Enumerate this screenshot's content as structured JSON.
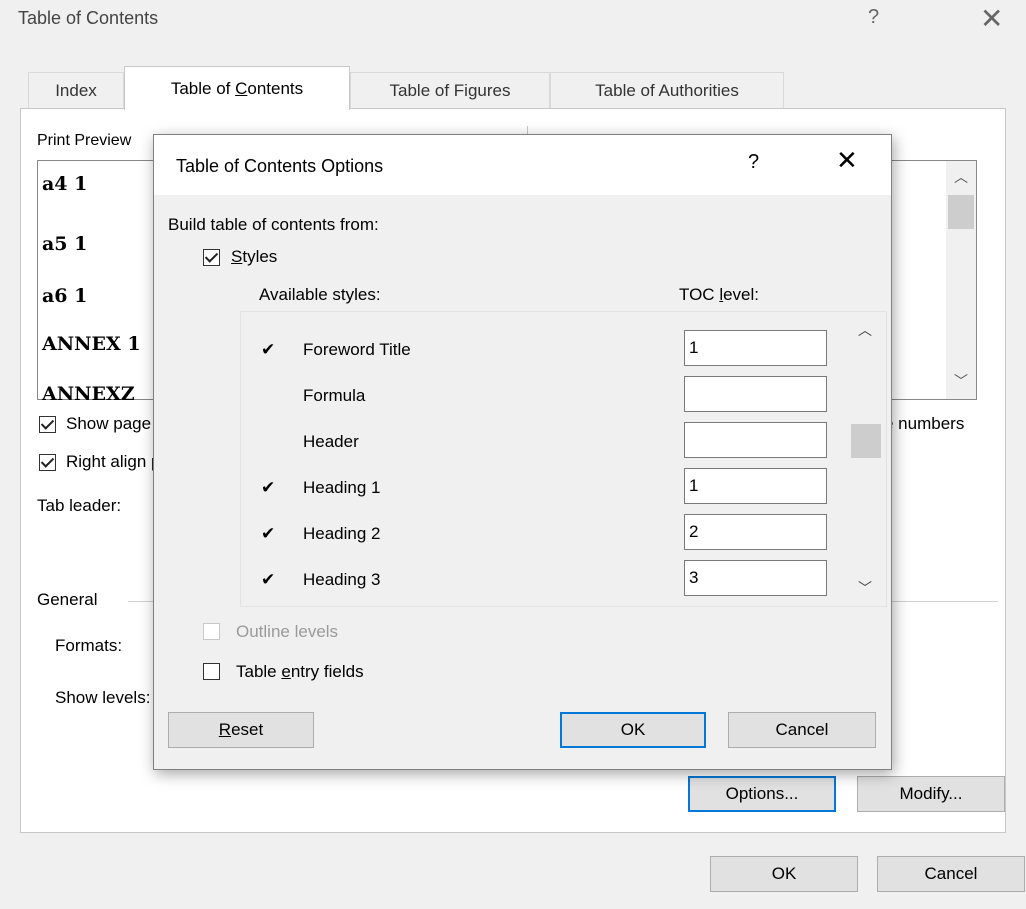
{
  "window": {
    "title": "Table of Contents",
    "help": "?",
    "close": "✕"
  },
  "tabs": [
    "Index",
    "Table of Contents",
    "Table of Figures",
    "Table of Authorities"
  ],
  "main": {
    "print_preview_label": "Print Preview",
    "preview_entries": [
      "a4 1",
      "a5 1",
      "a6 1",
      "ANNEX 1",
      "ANNEXZ"
    ],
    "show_page_numbers": "Show page numbers",
    "right_align": "Right align page numbers",
    "tab_leader": "Tab leader:",
    "web_hyperlinks_tail": "e numbers",
    "general": "General",
    "formats": "Formats:",
    "show_levels": "Show levels:",
    "options_button": "Options...",
    "modify_button": "Modify...",
    "ok_button": "OK",
    "cancel_button": "Cancel"
  },
  "dialog": {
    "title": "Table of Contents Options",
    "help": "?",
    "close": "✕",
    "build_from": "Build table of contents from:",
    "styles_label": "Styles",
    "available_styles": "Available styles:",
    "toc_level": "TOC level:",
    "rows": [
      {
        "mark": "✔",
        "name": "Foreword Title",
        "level": "1"
      },
      {
        "mark": "",
        "name": "Formula",
        "level": ""
      },
      {
        "mark": "",
        "name": "Header",
        "level": ""
      },
      {
        "mark": "✔",
        "name": "Heading 1",
        "level": "1"
      },
      {
        "mark": "✔",
        "name": "Heading 2",
        "level": "2"
      },
      {
        "mark": "✔",
        "name": "Heading 3",
        "level": "3"
      }
    ],
    "outline_levels": "Outline levels",
    "table_entry_fields": "Table entry fields",
    "reset_button": "Reset",
    "ok_button": "OK",
    "cancel_button": "Cancel"
  }
}
